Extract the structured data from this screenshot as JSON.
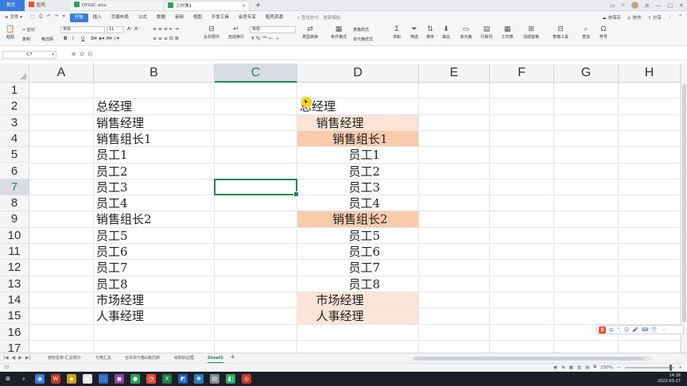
{
  "titlebar": {
    "tabs": [
      {
        "label": "首页",
        "color": "#3b7bd9"
      },
      {
        "label": "稻壳",
        "color": "#e8542a"
      },
      {
        "label": "DYSSC.xlsx",
        "color": "#2aa35a"
      },
      {
        "label": "工作簿1",
        "color": "#2aa35a"
      }
    ],
    "add": "+",
    "controls": [
      "▭",
      "⌕",
      "≡",
      "—",
      "▢",
      "✕"
    ]
  },
  "menubar": {
    "file": "≡ 文件 ▾",
    "qa_icons": [
      "🗀",
      "⎙",
      "↶",
      "↷",
      "▾"
    ],
    "items": [
      "开始",
      "插入",
      "页面布局",
      "公式",
      "数据",
      "审阅",
      "视图",
      "开发工具",
      "会员专享",
      "稻壳资源"
    ],
    "active_index": 0,
    "search_placeholder": "查找命令、搜索模板",
    "right": [
      "☁ 未保存",
      "♙ 协作",
      "⇪ 分享",
      "⋮",
      "^"
    ]
  },
  "ribbon": {
    "paste": "粘贴",
    "cut": "✂ 剪切",
    "copy": "复制",
    "format_painter": "格式刷",
    "font_name": "宋体",
    "font_size": "11",
    "bold": "B",
    "italic": "I",
    "underline": "U",
    "merge_center": "合并居中",
    "wrap": "自动换行",
    "number_format": "常规",
    "convert": "类型转换",
    "conditional": "条件格式",
    "cell_style": "单元格样式",
    "table_style": "表格样式",
    "sum": "求和",
    "filter": "筛选",
    "sort": "排序",
    "fill": "填充",
    "cell": "单元格",
    "row_col": "行和列",
    "worksheet": "工作表",
    "freeze": "冻结窗格",
    "table_tools": "表格工具",
    "find": "查找",
    "symbol": "符号"
  },
  "formula": {
    "namebox": "C7",
    "icons": [
      "⊕",
      "Q",
      "fx"
    ],
    "value": ""
  },
  "grid": {
    "columns": [
      "A",
      "B",
      "C",
      "D",
      "E",
      "F",
      "G",
      "H"
    ],
    "selected_col": "C",
    "rows": [
      "1",
      "2",
      "3",
      "4",
      "5",
      "6",
      "7",
      "8",
      "9",
      "10",
      "11",
      "12",
      "13",
      "14",
      "15",
      "16",
      "17"
    ],
    "selected_row": "7",
    "colB": [
      "",
      "总经理",
      "销售经理",
      "销售组长1",
      "员工1",
      "员工2",
      "员工3",
      "员工4",
      "销售组长2",
      "员工5",
      "员工6",
      "员工7",
      "员工8",
      "市场经理",
      "人事经理",
      "",
      ""
    ],
    "colD": [
      "",
      "总经理",
      "销售经理",
      "销售组长1",
      "员工1",
      "员工2",
      "员工3",
      "员工4",
      "销售组长2",
      "员工5",
      "员工6",
      "员工7",
      "员工8",
      "市场经理",
      "人事经理",
      "",
      ""
    ],
    "indent_levels_D": [
      0,
      0,
      1,
      2,
      3,
      3,
      3,
      3,
      2,
      3,
      3,
      3,
      3,
      1,
      1,
      0,
      0
    ],
    "fills_D": [
      "",
      "",
      "#fce4d6",
      "#f8cbad",
      "",
      "",
      "",
      "",
      "#f8cbad",
      "",
      "",
      "",
      "",
      "#fce4d6",
      "#fce4d6",
      "",
      ""
    ],
    "selection_color": "#1f8a52"
  },
  "ime": {
    "logo": "S",
    "items": [
      "中",
      "°,",
      "☺",
      "🎤",
      "⌨",
      "👕",
      "⋯"
    ]
  },
  "sheets": {
    "nav": [
      "|◀",
      "◀",
      "▶",
      "▶|"
    ],
    "tabs": [
      "按班名称-汇总统计",
      "分离汇总",
      "合并单元格&格式刷",
      "绘制斜边框",
      "Sheet5"
    ],
    "active_index": 4,
    "add": "+"
  },
  "status": {
    "left": "⊡",
    "zoom": "250%",
    "minus": "—",
    "plus": "+",
    "view_icons": [
      "◉",
      "⊞",
      "▦",
      "▥",
      "▤",
      "⧉"
    ]
  },
  "taskbar": {
    "icons": [
      {
        "glyph": "⊞",
        "color": "#1c1f26"
      },
      {
        "glyph": "⌕",
        "color": "#1c1f26"
      },
      {
        "glyph": "◉",
        "color": "#3b7bd9"
      },
      {
        "glyph": "W",
        "color": "#c0392b"
      },
      {
        "glyph": "◆",
        "color": "#d4a017"
      },
      {
        "glyph": "▣",
        "color": "#e6e6e6"
      },
      {
        "glyph": "⬚",
        "color": "#2b6cc4"
      },
      {
        "glyph": "◼",
        "color": "#8e44ad"
      },
      {
        "glyph": "●",
        "color": "#2aa35a"
      },
      {
        "glyph": "◔",
        "color": "#e74c3c"
      },
      {
        "glyph": "X",
        "color": "#1e7e45"
      },
      {
        "glyph": "◩",
        "color": "#1f5fbf"
      },
      {
        "glyph": "❋",
        "color": "#2980b9"
      },
      {
        "glyph": "▤",
        "color": "#7f8c8d"
      },
      {
        "glyph": "◧",
        "color": "#27ae60"
      },
      {
        "glyph": "◎",
        "color": "#c0392b"
      }
    ],
    "time": "14:18",
    "date": "2022-03-27"
  }
}
